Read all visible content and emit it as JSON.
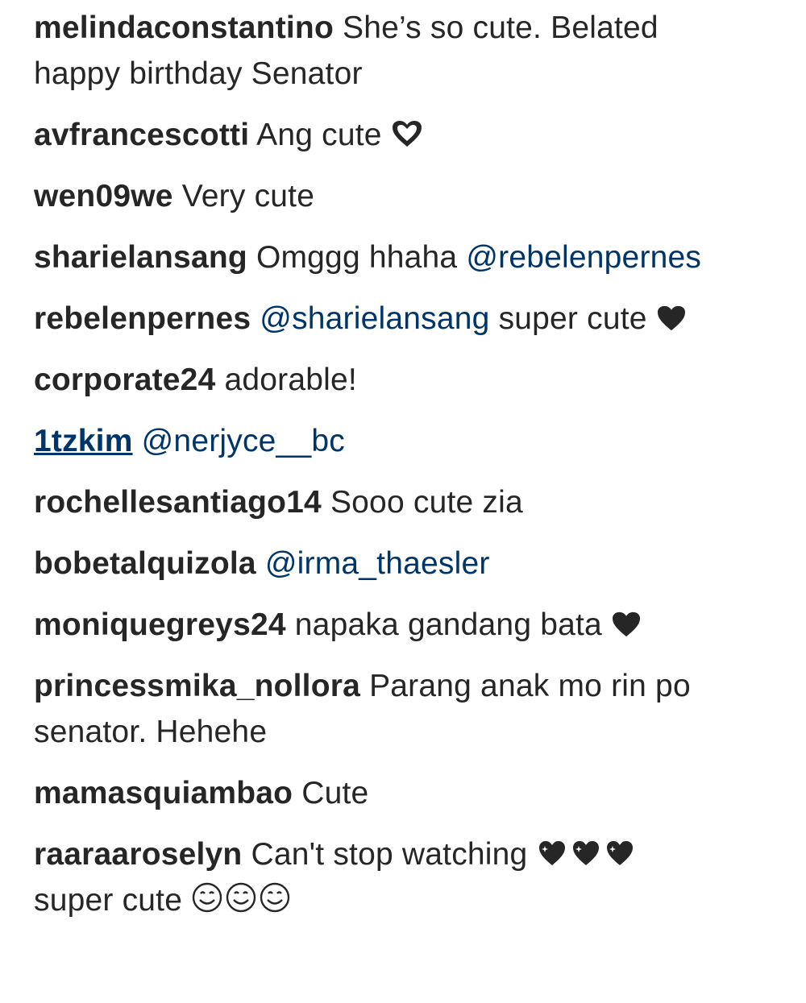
{
  "comments": [
    {
      "username": "melindaconstantino",
      "text": "She’s so cute. Belated happy birthday Senator"
    },
    {
      "username": "avfrancescotti",
      "text": "Ang cute",
      "emoji": "heart-outline-icon"
    },
    {
      "username": "wen09we",
      "text": "Very cute"
    },
    {
      "username": "sharielansang",
      "text": "Omggg hhaha",
      "mention": "@rebelenpernes"
    },
    {
      "username": "rebelenpernes",
      "mention": "@sharielansang",
      "text": "super cute",
      "emoji": "black-heart-icon"
    },
    {
      "username": "corporate24",
      "text": "adorable!"
    },
    {
      "username": "1tzkim",
      "mention": "@nerjyce__bc"
    },
    {
      "username": "rochellesantiago14",
      "text": "Sooo cute zia"
    },
    {
      "username": "bobetalquizola",
      "mention": "@irma_thaesler"
    },
    {
      "username": "moniquegreys24",
      "text": "napaka gandang bata",
      "emoji": "black-heart-icon"
    },
    {
      "username": "princessmika_nollora",
      "text": "Parang anak mo rin po senator. Hehehe"
    },
    {
      "username": "mamasquiambao",
      "text": "Cute"
    },
    {
      "username": "raaraaroselyn",
      "text": "Can't stop watching",
      "emoji": "triple-sparkling-heart-icon",
      "text2": "super cute",
      "emoji2": "triple-smiling-face-icon"
    }
  ],
  "colors": {
    "username": "#262626",
    "mention": "#003569",
    "text": "#262626",
    "background": "#ffffff"
  }
}
